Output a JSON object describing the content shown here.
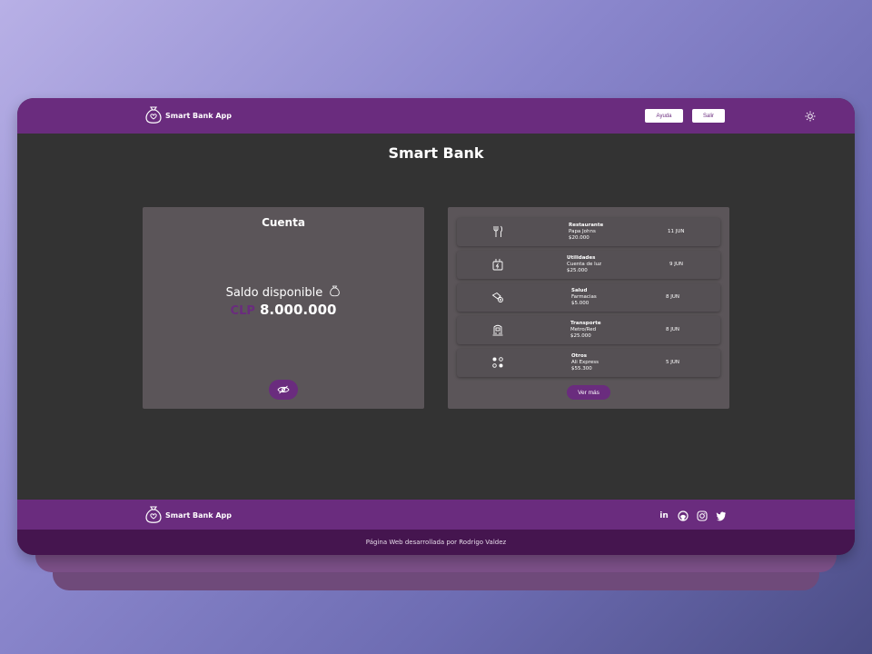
{
  "navbar": {
    "brand": "Smart Bank App",
    "help_label": "Ayuda",
    "logout_label": "Salir"
  },
  "page": {
    "title": "Smart Bank"
  },
  "account": {
    "title": "Cuenta",
    "balance_label": "Saldo disponible",
    "currency": "CLP",
    "amount": "8.000.000"
  },
  "transactions": {
    "items": [
      {
        "category": "Restaurante",
        "description": "Papa Johns",
        "amount": "$20.000",
        "date": "11 JUN",
        "icon": "utensils-icon"
      },
      {
        "category": "Utilidades",
        "description": "Cuenta de luz",
        "amount": "$25.000",
        "date": "9 JUN",
        "icon": "utilities-icon"
      },
      {
        "category": "Salud",
        "description": "Farmacias",
        "amount": "$5.000",
        "date": "8 JUN",
        "icon": "health-icon"
      },
      {
        "category": "Transporte",
        "description": "Metro/Red",
        "amount": "$25.000",
        "date": "8 JUN",
        "icon": "train-icon"
      },
      {
        "category": "Otros",
        "description": "Ali Express",
        "amount": "$55.300",
        "date": "5 JUN",
        "icon": "dots-icon"
      }
    ],
    "more_label": "Ver más"
  },
  "footer": {
    "brand": "Smart Bank App",
    "credit": "Página Web desarrollada por Rodrigo Valdez",
    "socials": [
      "linkedin-icon",
      "github-icon",
      "instagram-icon",
      "twitter-icon"
    ]
  },
  "colors": {
    "primary": "#6a2c7e",
    "footer_dark": "#45154f",
    "background": "#333333",
    "card": "#5b5559"
  }
}
